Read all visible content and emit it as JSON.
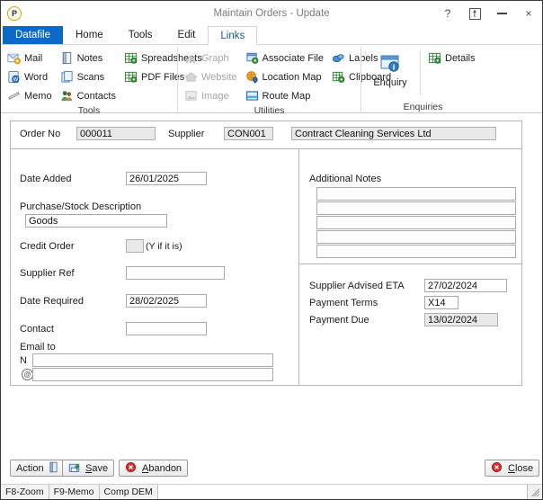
{
  "window": {
    "title": "Maintain Orders -  Update",
    "logo_letter": "P",
    "help_icon": "?",
    "restore_icon": "restore-icon",
    "minimize_icon": "minimize-icon",
    "close_icon": "×"
  },
  "tabs": [
    {
      "label": "Datafile",
      "state": "datafile"
    },
    {
      "label": "Home",
      "state": "normal"
    },
    {
      "label": "Tools",
      "state": "normal"
    },
    {
      "label": "Edit",
      "state": "normal"
    },
    {
      "label": "Links",
      "state": "active"
    }
  ],
  "ribbon": {
    "groups": [
      {
        "title": "Tools",
        "columns": [
          [
            {
              "label": "Mail",
              "icon": "mail-icon",
              "disabled": false
            },
            {
              "label": "Word",
              "icon": "word-icon",
              "disabled": false
            },
            {
              "label": "Memo",
              "icon": "memo-icon",
              "disabled": false
            }
          ],
          [
            {
              "label": "Notes",
              "icon": "notes-icon",
              "disabled": false
            },
            {
              "label": "Scans",
              "icon": "scans-icon",
              "disabled": false
            },
            {
              "label": "Contacts",
              "icon": "contacts-icon",
              "disabled": false
            }
          ],
          [
            {
              "label": "Spreadsheets",
              "icon": "spreadsheet-icon",
              "disabled": false
            },
            {
              "label": "PDF Files",
              "icon": "pdf-icon",
              "disabled": false
            }
          ]
        ]
      },
      {
        "title": "Utilities",
        "columns": [
          [
            {
              "label": "Graph",
              "icon": "graph-icon",
              "disabled": true
            },
            {
              "label": "Website",
              "icon": "website-icon",
              "disabled": true
            },
            {
              "label": "Image",
              "icon": "image-icon",
              "disabled": true
            }
          ],
          [
            {
              "label": "Associate File",
              "icon": "associate-file-icon",
              "disabled": false
            },
            {
              "label": "Location Map",
              "icon": "location-map-icon",
              "disabled": false
            },
            {
              "label": "Route Map",
              "icon": "route-map-icon",
              "disabled": false
            }
          ],
          [
            {
              "label": "Labels",
              "icon": "labels-icon",
              "disabled": false
            },
            {
              "label": "Clipboard",
              "icon": "clipboard-icon",
              "disabled": false
            }
          ]
        ]
      },
      {
        "title": "Enquiries",
        "big": {
          "label": "Enquiry",
          "icon": "enquiry-icon"
        },
        "columns": [
          [
            {
              "label": "Details",
              "icon": "details-icon",
              "disabled": false
            }
          ]
        ]
      }
    ]
  },
  "form": {
    "order_no_label": "Order No",
    "order_no_value": "000011",
    "supplier_label": "Supplier",
    "supplier_code_value": "CON001",
    "supplier_name_value": "Contract Cleaning Services Ltd",
    "date_added_label": "Date Added",
    "date_added_value": "26/01/2025",
    "description_label": "Purchase/Stock Description",
    "description_value": "Goods",
    "credit_order_label": "Credit Order",
    "credit_order_value": "",
    "credit_order_hint": "(Y if it is)",
    "supplier_ref_label": "Supplier Ref",
    "supplier_ref_value": "",
    "date_required_label": "Date Required",
    "date_required_value": "28/02/2025",
    "contact_label": "Contact",
    "contact_value": "",
    "email_to_label": "Email to",
    "email_name_label": "N",
    "email_name_value": "",
    "email_address_icon": "at-icon",
    "email_address_value": "",
    "additional_notes_label": "Additional Notes",
    "additional_notes": [
      "",
      "",
      "",
      "",
      ""
    ],
    "eta_label": "Supplier Advised ETA",
    "eta_value": "27/02/2024",
    "payment_terms_label": "Payment Terms",
    "payment_terms_value": "X14",
    "payment_due_label": "Payment Due",
    "payment_due_value": "13/02/2024"
  },
  "buttons": {
    "action": {
      "label": "Action",
      "icon": "action-icon"
    },
    "save": {
      "label_pre": "",
      "label_key": "S",
      "label_post": "ave",
      "icon": "save-icon"
    },
    "abandon": {
      "label_pre": "",
      "label_key": "A",
      "label_post": "bandon",
      "icon": "abandon-icon"
    },
    "close": {
      "label_pre": "",
      "label_key": "C",
      "label_post": "lose",
      "icon": "close-button-icon"
    }
  },
  "statusbar": {
    "cells": [
      "F8-Zoom",
      "F9-Memo",
      "Comp DEM"
    ]
  },
  "colors": {
    "accent": "#0b69c7",
    "tab_active_text": "#17599e",
    "readonly_bg": "#e9e9e9",
    "border": "#b6b6b6"
  }
}
